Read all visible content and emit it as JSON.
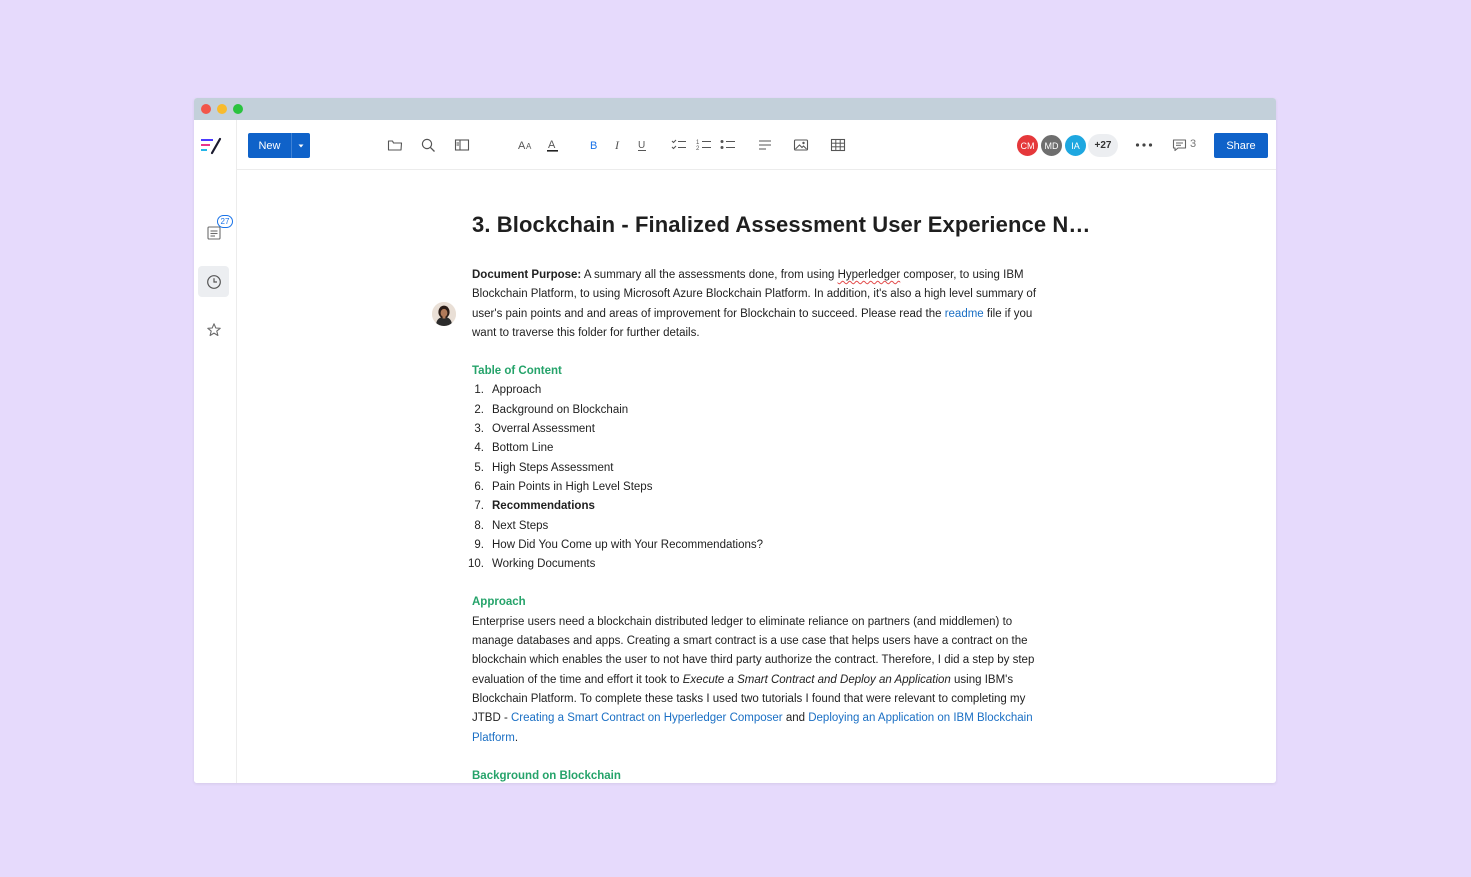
{
  "toolbar": {
    "new_label": "New",
    "share_label": "Share",
    "more_collaborators": "+27",
    "comment_count": "3",
    "collaborators": [
      {
        "initials": "CM",
        "color": "#e5383b"
      },
      {
        "initials": "MD",
        "color": "#6e6e6e"
      },
      {
        "initials": "IA",
        "color": "#1ea7e0"
      }
    ]
  },
  "sidebar": {
    "docs_badge": "27"
  },
  "document": {
    "title": "3. Blockchain - Finalized Assessment User Experience N…",
    "purpose_label": "Document Purpose:",
    "purpose_part1": " A summary all the assessments done, from using ",
    "purpose_spell": "Hyperledger",
    "purpose_part2": " composer, to using IBM Blockchain Platform, to using Microsoft Azure Blockchain Platform. In addition, it's also a high level summary of user's pain points and and areas of improvement for Blockchain to succeed. Please read the ",
    "purpose_link": "readme",
    "purpose_part3": " file if you want to traverse this folder for further details.",
    "toc_heading": "Table of Content",
    "toc": [
      {
        "num": "1.",
        "text": "Approach"
      },
      {
        "num": "2.",
        "text": "Background on Blockchain"
      },
      {
        "num": "3.",
        "text": "Overral Assessment"
      },
      {
        "num": "4.",
        "text": "Bottom Line"
      },
      {
        "num": "5.",
        "text": "High Steps Assessment"
      },
      {
        "num": "6.",
        "text": "Pain Points in High Level Steps"
      },
      {
        "num": "7.",
        "text": "Recommendations"
      },
      {
        "num": "8.",
        "text": "Next Steps"
      },
      {
        "num": "9.",
        "text": "How Did You Come up with Your Recommendations?"
      },
      {
        "num": "10.",
        "text": "Working Documents"
      }
    ],
    "approach_heading": "Approach",
    "approach_part1": "Enterprise users need a blockchain distributed ledger to eliminate reliance on partners (and middlemen) to manage databases and apps. Creating a smart contract is a use case that helps users have a contract on the blockchain which enables the user to not have third party authorize the contract. Therefore, I did a step by step evaluation of the time and effort it took to ",
    "approach_italic": "Execute a Smart Contract and Deploy an Application",
    "approach_part2": " using IBM's Blockchain Platform. To complete these tasks I used two tutorials I found that were relevant to completing my JTBD - ",
    "approach_link1": "Creating a Smart Contract on Hyperledger Composer",
    "approach_and": " and ",
    "approach_link2": "Deploying an Application on IBM Blockchain Platform",
    "approach_end": ".",
    "next_heading": "Background on Blockchain"
  }
}
